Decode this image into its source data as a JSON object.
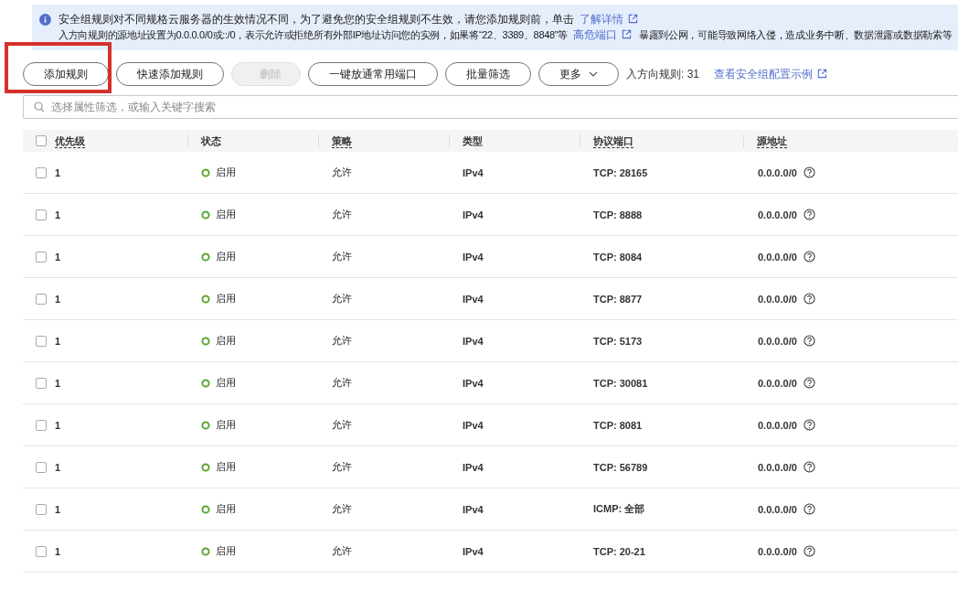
{
  "notice": {
    "line_1": "安全组规则对不同规格云服务器的生效情况不同，为了避免您的安全组规则不生效，请您添加规则前，单击",
    "link_1": "了解详情",
    "line_2_start": "入方向规则的源地址设置为0.0.0.0/0或::/0，表示允许或拒绝所有外部IP地址访问您的实例，如果将“22、3389、8848”等",
    "link_2": "高危端口",
    "line_2_end": "暴露到公网，可能导致网络入侵，造成业务中断、数据泄露或数据勒索等"
  },
  "toolbar": {
    "buttons": [
      {
        "label": "添加规则",
        "disabled": false,
        "dropdown": false,
        "highlighted": true
      },
      {
        "label": "快速添加规则",
        "disabled": false,
        "dropdown": false,
        "highlighted": false
      },
      {
        "label": "删除",
        "disabled": true,
        "dropdown": false,
        "highlighted": false
      },
      {
        "label": "一键放通常用端口",
        "disabled": false,
        "dropdown": false,
        "highlighted": false
      },
      {
        "label": "批量筛选",
        "disabled": false,
        "dropdown": false,
        "highlighted": false
      },
      {
        "label": "更多",
        "disabled": false,
        "dropdown": true,
        "highlighted": false
      }
    ],
    "rule_count": "入方向规则: 31",
    "example_link": "查看安全组配置示例"
  },
  "search": {
    "placeholder": "选择属性筛选，或输入关键字搜索"
  },
  "table": {
    "all_checked": false,
    "columns": [
      {
        "label": "优先级",
        "has_tip": true
      },
      {
        "label": "状态",
        "has_tip": false
      },
      {
        "label": "策略",
        "has_tip": true
      },
      {
        "label": "类型",
        "has_tip": false
      },
      {
        "label": "协议端口",
        "has_tip": true
      },
      {
        "label": "源地址",
        "has_tip": true
      }
    ],
    "rows": [
      {
        "checked": false,
        "priority": "1",
        "status": "启用",
        "policy": "允许",
        "type": "IPv4",
        "port": "TCP: 28165",
        "source": "0.0.0.0/0"
      },
      {
        "checked": false,
        "priority": "1",
        "status": "启用",
        "policy": "允许",
        "type": "IPv4",
        "port": "TCP: 8888",
        "source": "0.0.0.0/0"
      },
      {
        "checked": false,
        "priority": "1",
        "status": "启用",
        "policy": "允许",
        "type": "IPv4",
        "port": "TCP: 8084",
        "source": "0.0.0.0/0"
      },
      {
        "checked": false,
        "priority": "1",
        "status": "启用",
        "policy": "允许",
        "type": "IPv4",
        "port": "TCP: 8877",
        "source": "0.0.0.0/0"
      },
      {
        "checked": false,
        "priority": "1",
        "status": "启用",
        "policy": "允许",
        "type": "IPv4",
        "port": "TCP: 5173",
        "source": "0.0.0.0/0"
      },
      {
        "checked": false,
        "priority": "1",
        "status": "启用",
        "policy": "允许",
        "type": "IPv4",
        "port": "TCP: 30081",
        "source": "0.0.0.0/0"
      },
      {
        "checked": false,
        "priority": "1",
        "status": "启用",
        "policy": "允许",
        "type": "IPv4",
        "port": "TCP: 8081",
        "source": "0.0.0.0/0"
      },
      {
        "checked": false,
        "priority": "1",
        "status": "启用",
        "policy": "允许",
        "type": "IPv4",
        "port": "TCP: 56789",
        "source": "0.0.0.0/0"
      },
      {
        "checked": false,
        "priority": "1",
        "status": "启用",
        "policy": "允许",
        "type": "IPv4",
        "port": "ICMP: 全部",
        "source": "0.0.0.0/0"
      },
      {
        "checked": false,
        "priority": "1",
        "status": "启用",
        "policy": "允许",
        "type": "IPv4",
        "port": "TCP: 20-21",
        "source": "0.0.0.0/0"
      }
    ]
  }
}
